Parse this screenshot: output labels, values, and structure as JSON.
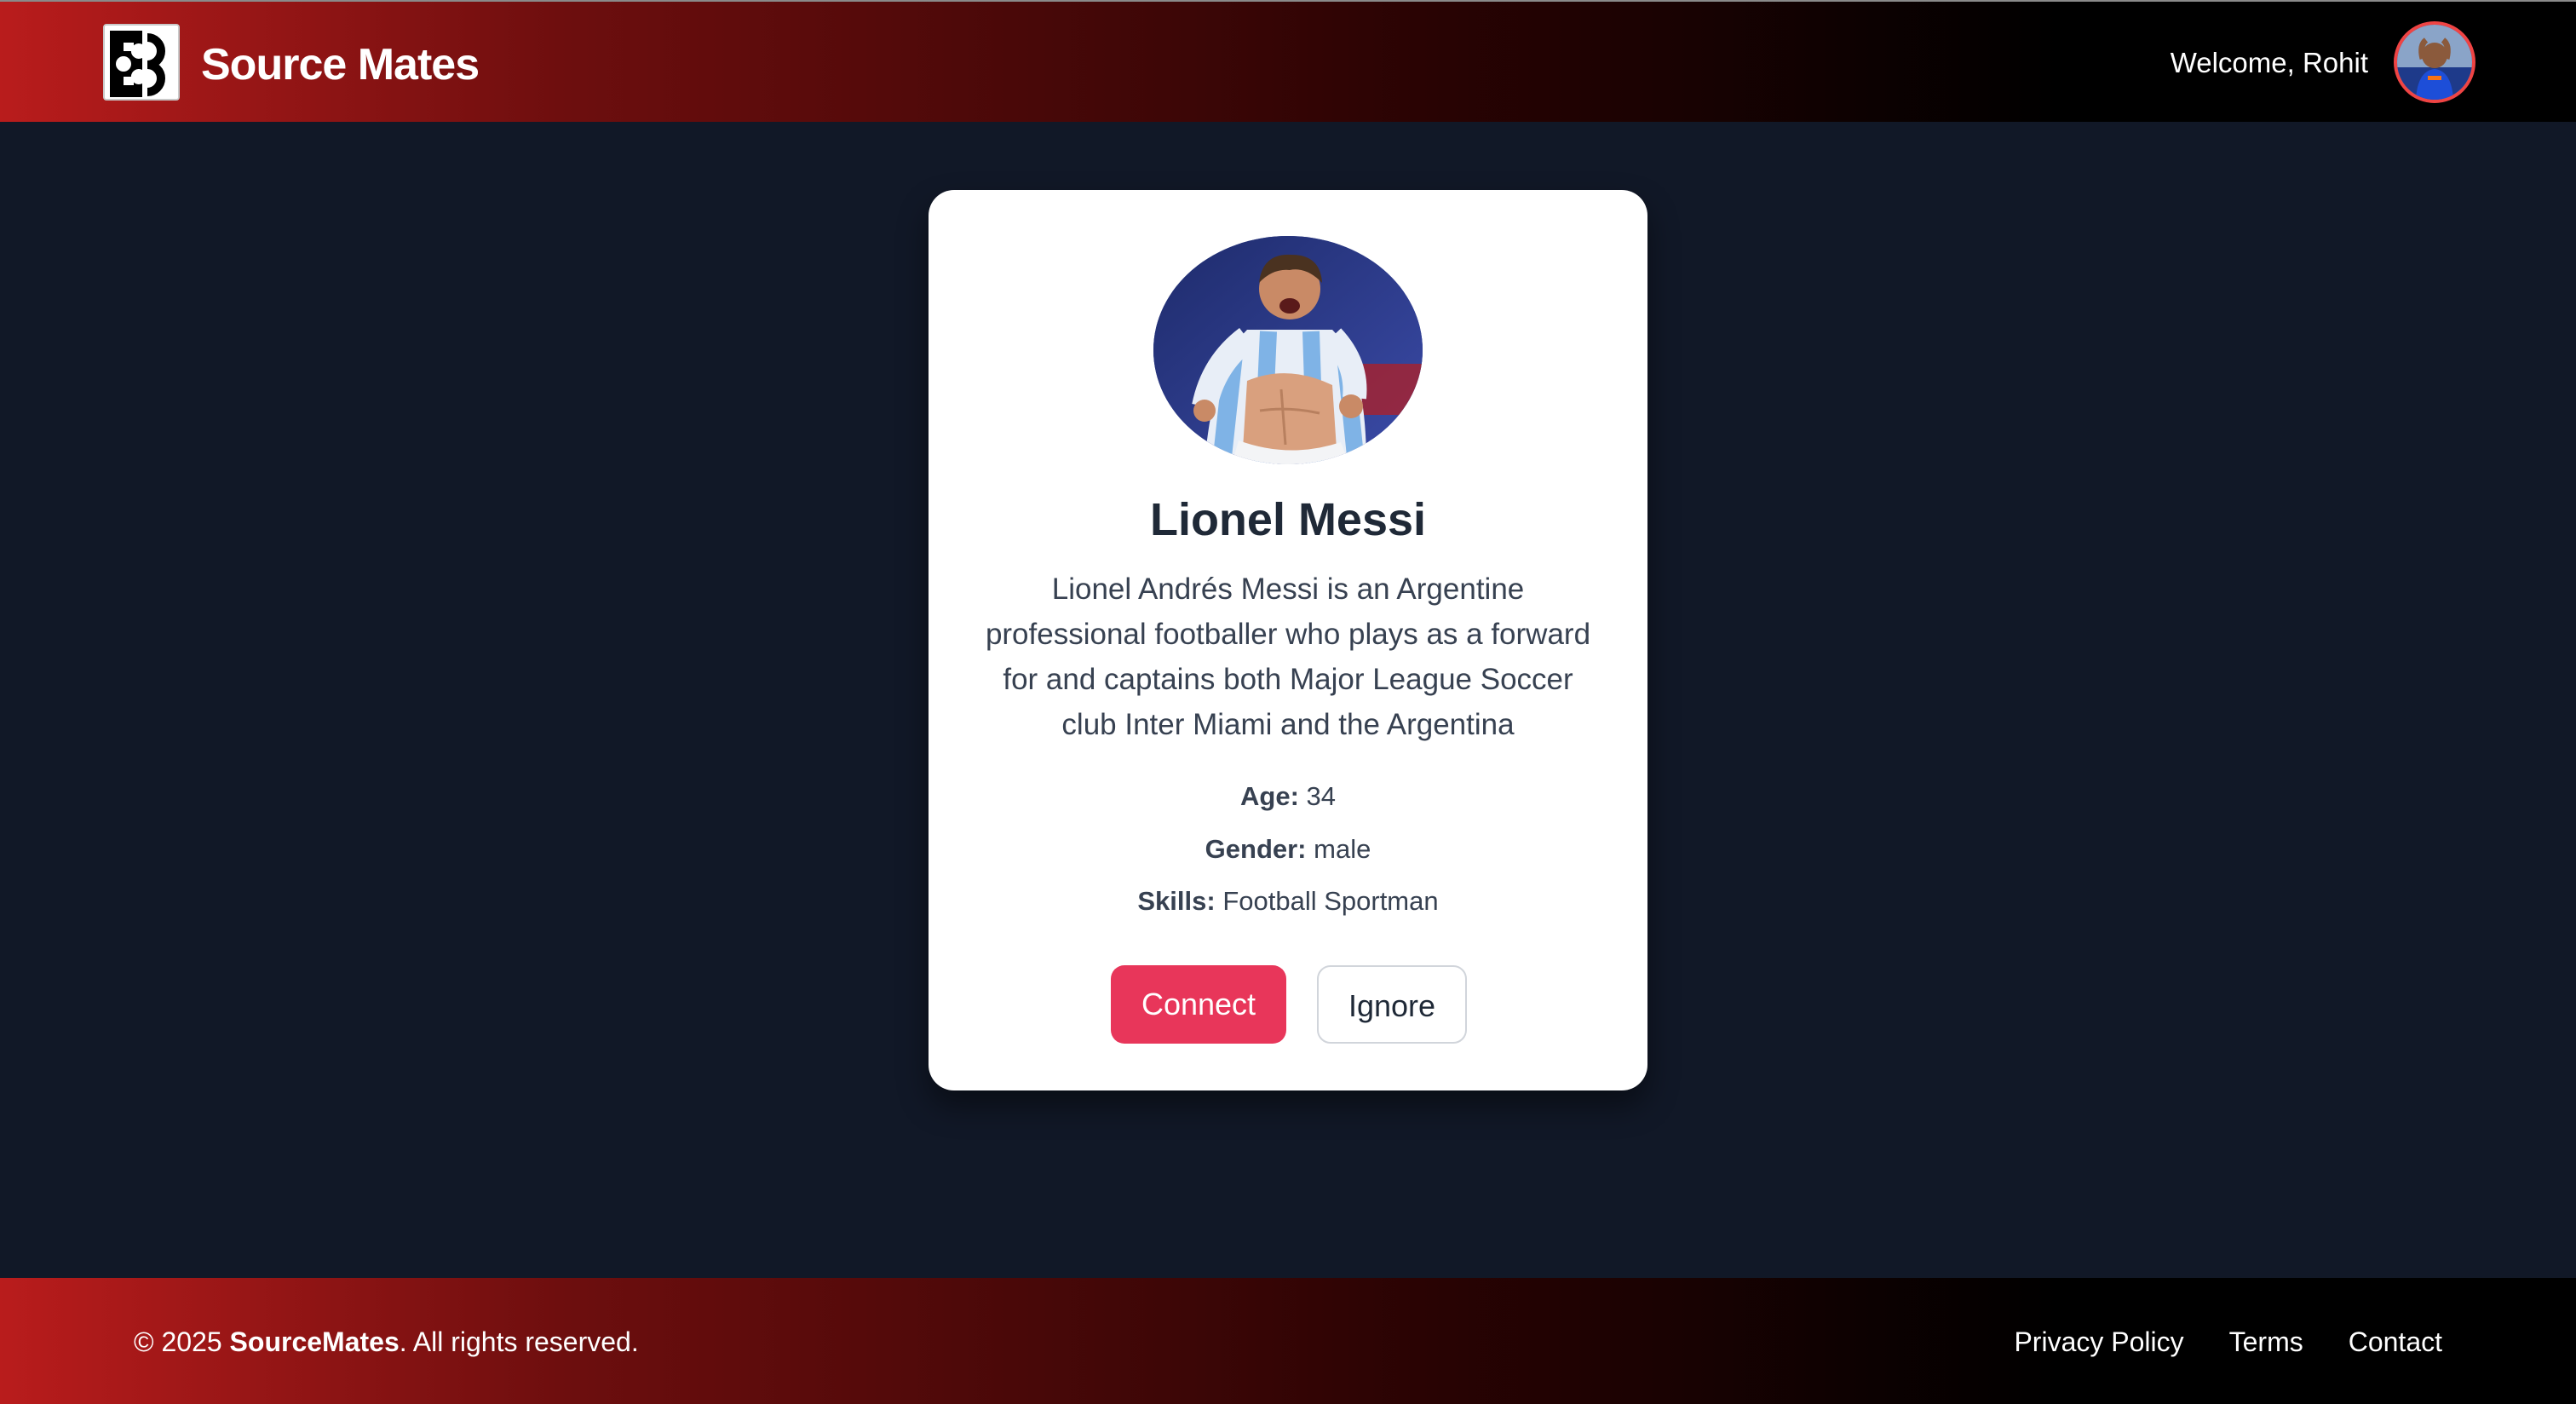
{
  "header": {
    "brand_name": "Source Mates",
    "logo_icon": "puzzle-logo-icon",
    "welcome_text": "Welcome, Rohit",
    "user_avatar": "user-avatar-photo"
  },
  "profile": {
    "photo": "profile-photo",
    "name": "Lionel Messi",
    "bio": "Lionel Andrés Messi is an Argentine professional footballer who plays as a forward for and captains both Major League Soccer club Inter Miami and the Argentina",
    "age_label": "Age:",
    "age_value": "34",
    "gender_label": "Gender:",
    "gender_value": "male",
    "skills_label": "Skills:",
    "skills_value": "Football Sportman",
    "connect_label": "Connect",
    "ignore_label": "Ignore"
  },
  "footer": {
    "copyright_prefix": "© 2025 ",
    "copyright_brand": "SourceMates",
    "copyright_suffix": ". All rights reserved.",
    "links": [
      "Privacy Policy",
      "Terms",
      "Contact"
    ]
  },
  "colors": {
    "accent": "#e8365a",
    "header_gradient_start": "#b91c1c",
    "background": "#111827"
  }
}
